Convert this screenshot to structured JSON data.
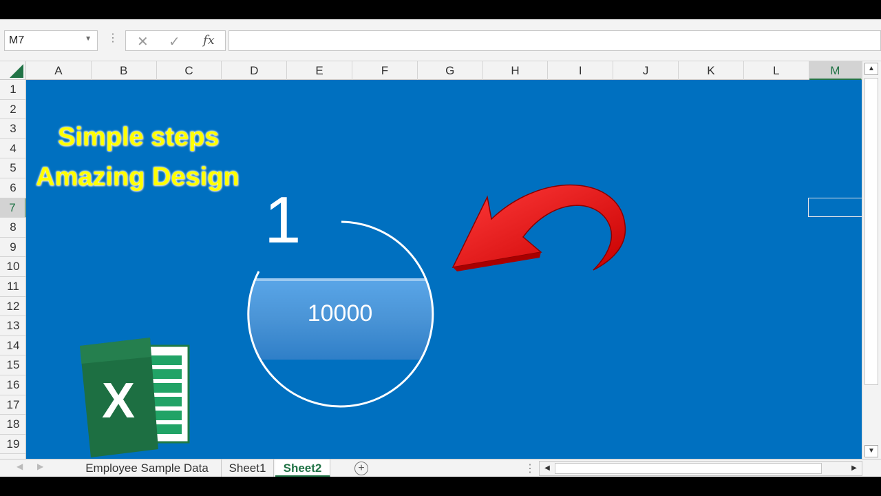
{
  "formula_bar": {
    "name_box": "M7",
    "cancel_icon": "✕",
    "enter_icon": "✓",
    "fx_label": "fx",
    "formula": ""
  },
  "columns": [
    "A",
    "B",
    "C",
    "D",
    "E",
    "F",
    "G",
    "H",
    "I",
    "J",
    "K",
    "L",
    "M"
  ],
  "selected_column": "M",
  "rows": [
    "1",
    "2",
    "3",
    "4",
    "5",
    "6",
    "7",
    "8",
    "9",
    "10",
    "11",
    "12",
    "13",
    "14",
    "15",
    "16",
    "17",
    "18",
    "19"
  ],
  "selected_row": "7",
  "sheet": {
    "title_line1": "Simple steps",
    "title_line2": "Amazing Design",
    "big_number": "1",
    "gauge_value": "10000",
    "background_color": "#0070c0"
  },
  "tabs": [
    {
      "label": "Employee Sample Data",
      "active": false
    },
    {
      "label": "Sheet1",
      "active": false
    },
    {
      "label": "Sheet2",
      "active": true
    }
  ],
  "add_sheet_icon": "+",
  "icons": {
    "corner": "select-all-triangle-icon",
    "arrow": "red-curved-arrow-icon",
    "logo": "excel-logo-icon"
  }
}
